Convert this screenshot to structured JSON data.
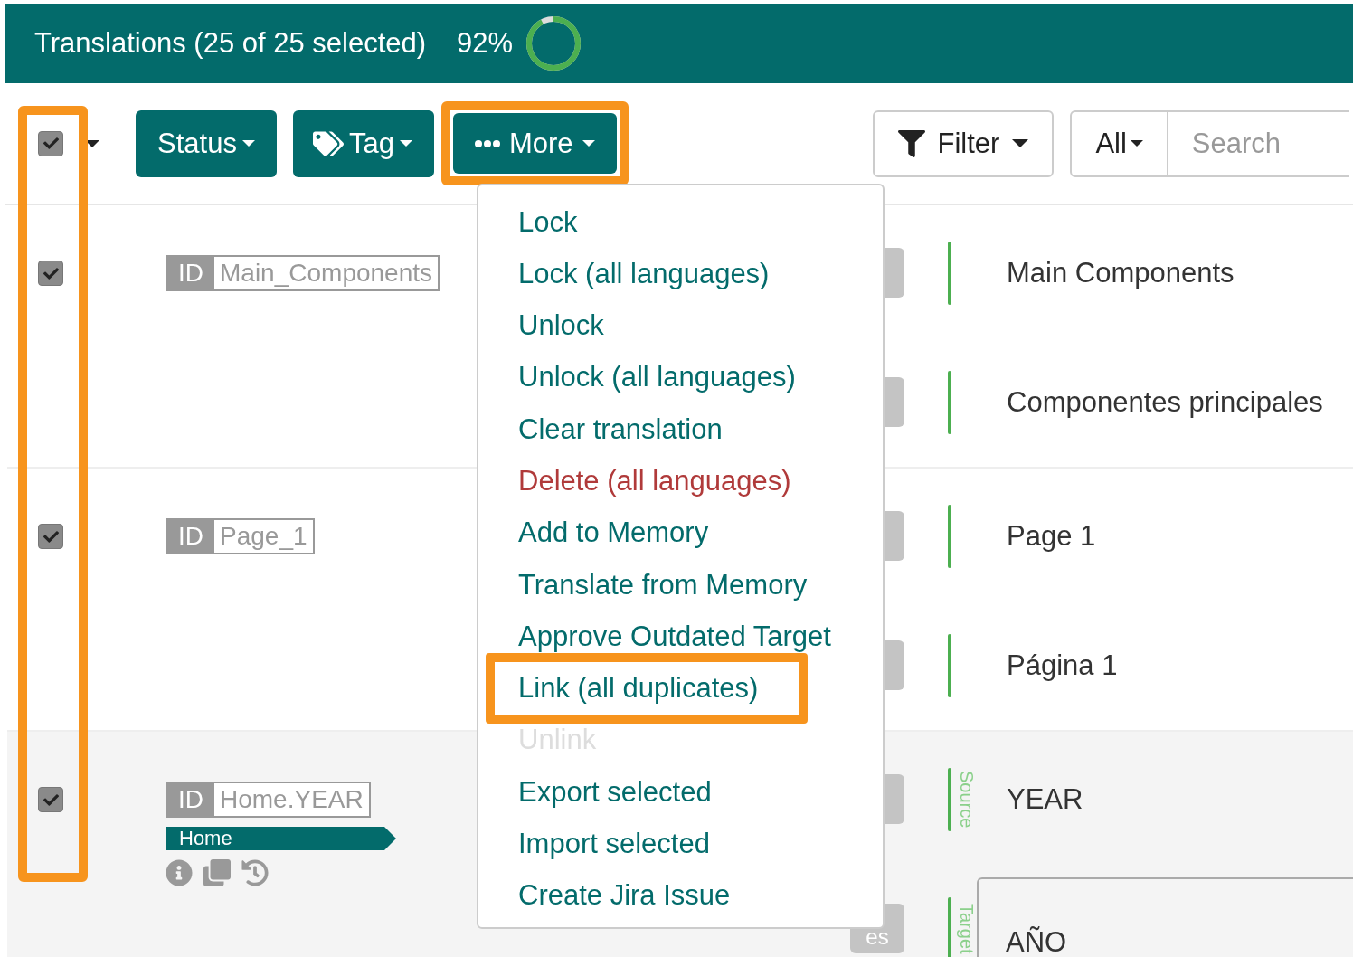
{
  "header": {
    "title": "Translations (25 of 25 selected)",
    "percent": "92%",
    "progress": {
      "level": 0.92
    }
  },
  "toolbar": {
    "select_all": {
      "checked": true
    },
    "status_button": "Status",
    "tag_button": "Tag",
    "more_button": {
      "label": "More",
      "highlighted": true
    },
    "filter_button": "Filter",
    "scope_dropdown": "All",
    "search": {
      "placeholder": "Search"
    }
  },
  "select_column_highlighted": true,
  "rows": [
    {
      "checked": true,
      "id_label": "ID",
      "id": "Main_Components",
      "icons": false,
      "lines": [
        {
          "text": "Main Components",
          "editing": false
        },
        {
          "text": "Componentes principales",
          "editing": false
        }
      ]
    },
    {
      "checked": true,
      "id_label": "ID",
      "id": "Page_1",
      "icons": false,
      "lines": [
        {
          "text": "Page 1",
          "editing": false
        },
        {
          "text": "Página 1",
          "editing": false
        }
      ]
    },
    {
      "checked": true,
      "id_label": "ID",
      "id": "Home.YEAR",
      "tag": "Home",
      "icons": true,
      "lines": [
        {
          "text": "YEAR",
          "side_label": "Source",
          "editing": false
        },
        {
          "text": "AÑO",
          "side_label": "Target",
          "badge": "es",
          "editing": true
        }
      ]
    }
  ],
  "more_menu": {
    "items": [
      {
        "label": "Lock",
        "kind": "action",
        "highlighted": false
      },
      {
        "label": "Lock (all languages)",
        "kind": "action",
        "highlighted": false
      },
      {
        "label": "Unlock",
        "kind": "action",
        "highlighted": false
      },
      {
        "label": "Unlock (all languages)",
        "kind": "action",
        "highlighted": false
      },
      {
        "label": "Clear translation",
        "kind": "action",
        "highlighted": false
      },
      {
        "label": "Delete (all languages)",
        "kind": "danger",
        "highlighted": false
      },
      {
        "label": "Add to Memory",
        "kind": "action",
        "highlighted": false
      },
      {
        "label": "Translate from Memory",
        "kind": "action",
        "highlighted": false
      },
      {
        "label": "Approve Outdated Target",
        "kind": "action",
        "highlighted": false
      },
      {
        "label": "Link (all duplicates)",
        "kind": "action",
        "highlighted": true
      },
      {
        "label": "Unlink",
        "kind": "disabled",
        "highlighted": false
      },
      {
        "label": "Export selected",
        "kind": "action",
        "highlighted": false
      },
      {
        "label": "Import selected",
        "kind": "action",
        "highlighted": false
      },
      {
        "label": "Create Jira Issue",
        "kind": "action",
        "highlighted": false
      }
    ]
  }
}
